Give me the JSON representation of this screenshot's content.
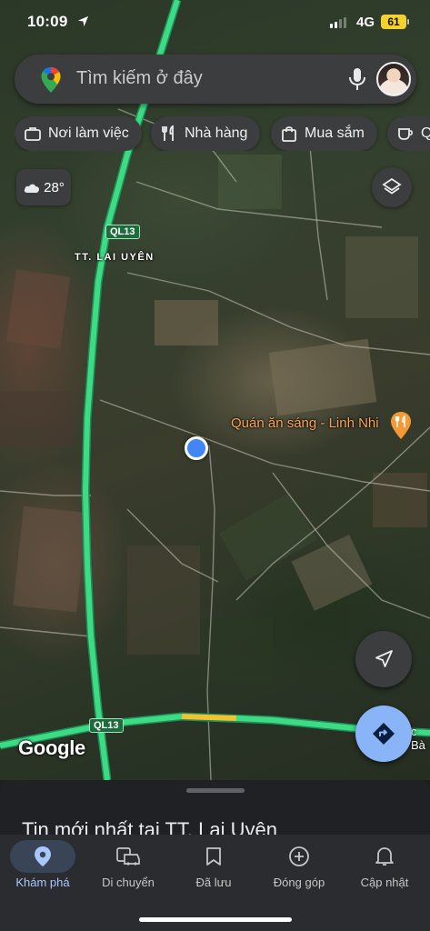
{
  "status_bar": {
    "time": "10:09",
    "network": "4G",
    "battery": "61",
    "signal_bars": 2
  },
  "search": {
    "placeholder": "Tìm kiếm ở đây",
    "pin_icon": "google-maps-pin-icon",
    "mic_icon": "microphone-icon"
  },
  "chips": [
    {
      "label": "Nơi làm việc",
      "icon": "briefcase-icon"
    },
    {
      "label": "Nhà hàng",
      "icon": "fork-knife-icon"
    },
    {
      "label": "Mua sắm",
      "icon": "shopping-bag-icon"
    },
    {
      "label": "Q",
      "icon": "coffee-cup-icon"
    }
  ],
  "weather": {
    "temperature": "28°",
    "icon": "cloud-icon"
  },
  "map": {
    "road_shield_1": "QL13",
    "road_shield_2": "QL13",
    "town_label": "TT. LAI UYÊN",
    "poi_label": "Quán ăn sáng - Linh Nhi",
    "poi_icon": "restaurant-pin-icon",
    "edge_label": "c Bà",
    "attribution": "Google",
    "route_color": "#3ddc84",
    "route_alt_color": "#f2c230"
  },
  "sheet": {
    "title": "Tin mới nhất tại TT. Lai Uyên"
  },
  "nav": [
    {
      "label": "Khám phá",
      "icon": "explore-pin-icon",
      "active": true
    },
    {
      "label": "Di chuyển",
      "icon": "commute-car-icon",
      "active": false
    },
    {
      "label": "Đã lưu",
      "icon": "bookmark-icon",
      "active": false
    },
    {
      "label": "Đóng góp",
      "icon": "add-circle-icon",
      "active": false
    },
    {
      "label": "Cập nhật",
      "icon": "bell-icon",
      "active": false
    }
  ],
  "colors": {
    "accent": "#8ab4f8",
    "active_nav": "#a8c7fa",
    "location_dot": "#4285f4"
  }
}
